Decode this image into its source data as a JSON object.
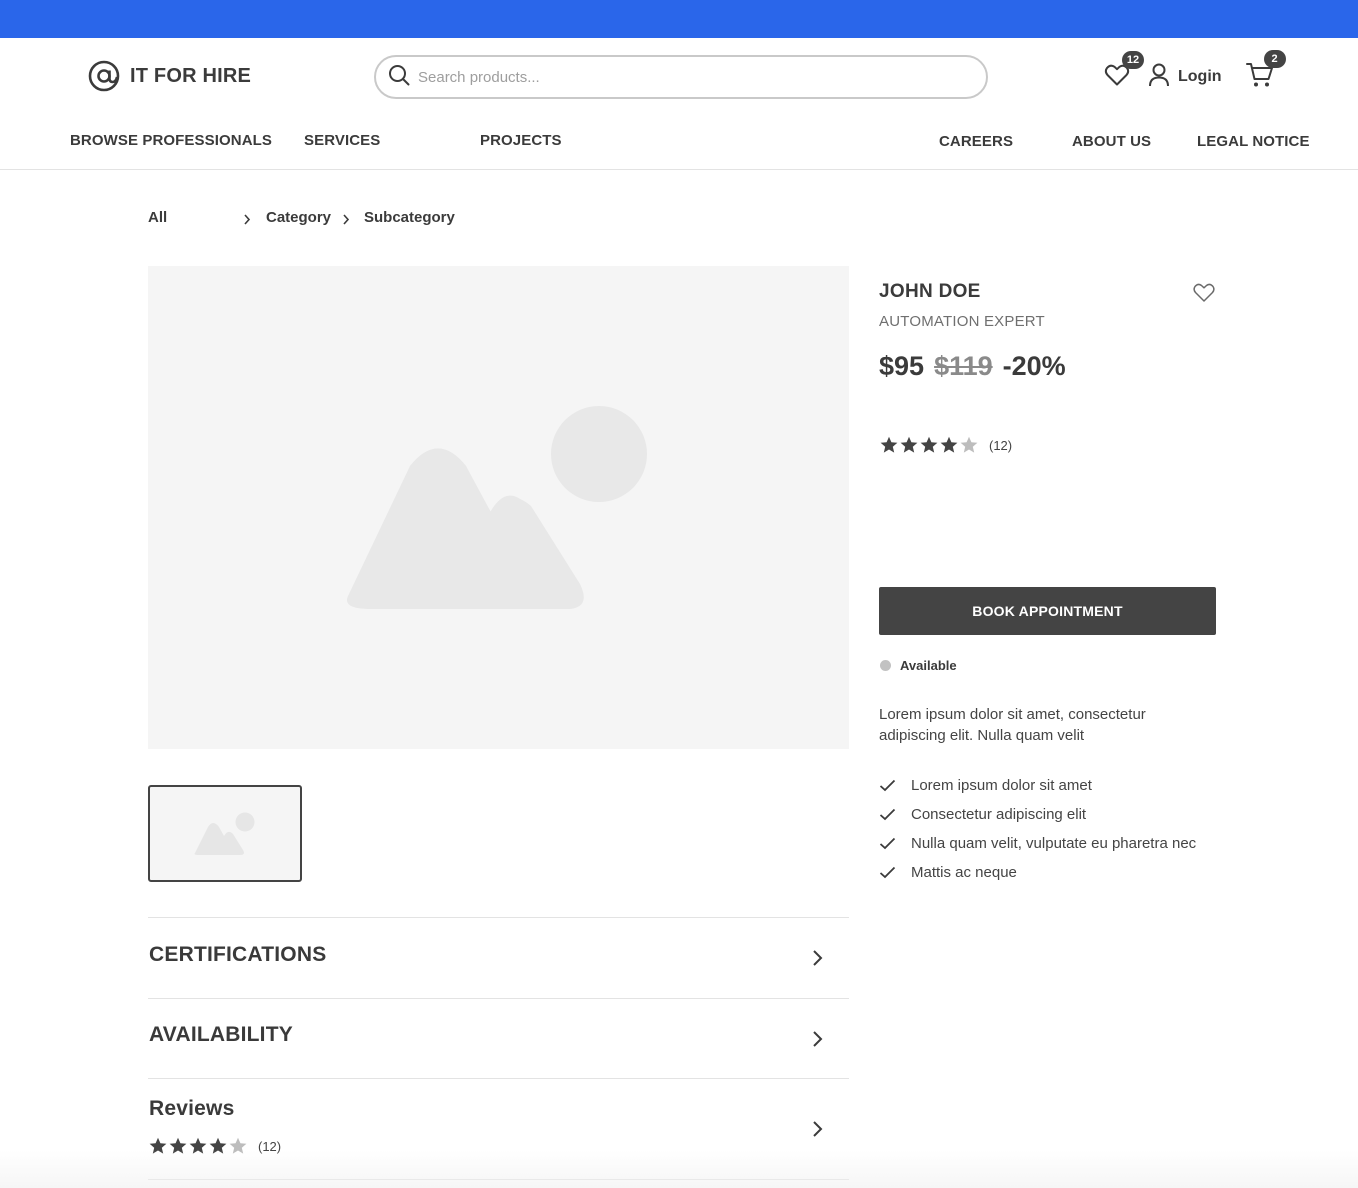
{
  "brand": {
    "name": "IT FOR HIRE",
    "logo_icon": "at-sign-icon",
    "accent_color": "#2a66ea"
  },
  "search": {
    "placeholder": "Search products..."
  },
  "header": {
    "wishlist_count": "12",
    "login_label": "Login",
    "cart_count": "2"
  },
  "nav": {
    "left": [
      "BROWSE PROFESSIONALS",
      "SERVICES",
      "PROJECTS"
    ],
    "right": [
      "CAREERS",
      "ABOUT US",
      "LEGAL NOTICE"
    ]
  },
  "breadcrumb": [
    "All",
    "Category",
    "Subcategory"
  ],
  "product": {
    "name": "JOHN DOE",
    "title": "AUTOMATION EXPERT",
    "price": "$95",
    "old_price": "$119",
    "discount": "-20%",
    "rating": 4,
    "rating_max": 5,
    "review_count": "(12)",
    "book_label": "BOOK APPOINTMENT",
    "availability": "Available",
    "description": "Lorem ipsum dolor sit amet, consectetur adipiscing elit. Nulla quam velit",
    "features": [
      "Lorem ipsum dolor sit amet",
      "Consectetur adipiscing elit",
      "Nulla quam velit, vulputate eu pharetra nec",
      "Mattis ac neque"
    ]
  },
  "accordion": {
    "certifications": "CERTIFICATIONS",
    "availability": "AVAILABILITY",
    "reviews": "Reviews",
    "reviews_rating": 4,
    "reviews_count": "(12)"
  }
}
